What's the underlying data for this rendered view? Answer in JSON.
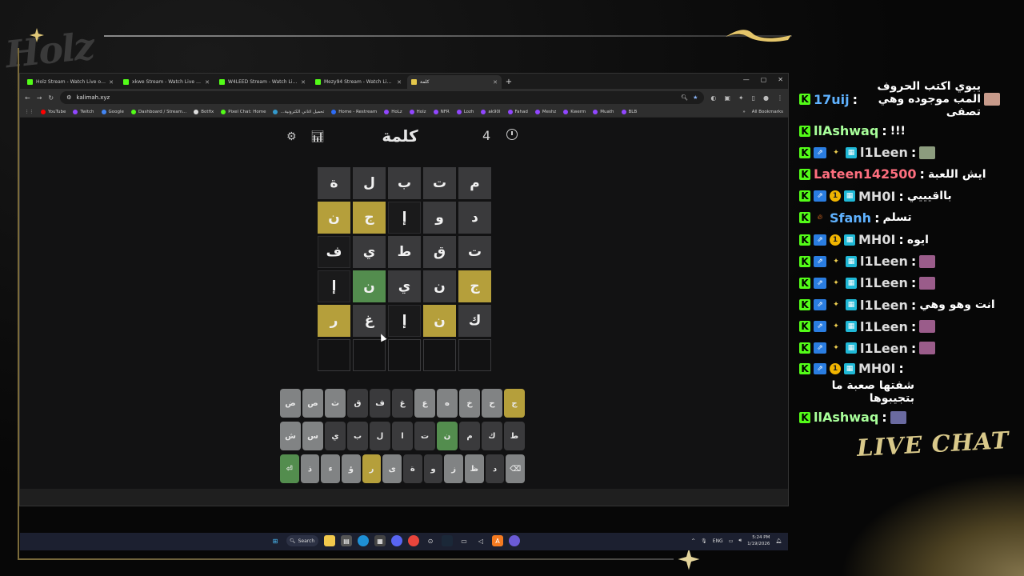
{
  "overlay": {
    "brand": "Holz",
    "live_chat_label": "LIVE CHAT"
  },
  "browser": {
    "tabs": [
      {
        "label": "Holz Stream - Watch Live on Ki",
        "active": false,
        "color": "#53fc18"
      },
      {
        "label": "xkwe Stream - Watch Live on Ki",
        "active": false,
        "color": "#53fc18"
      },
      {
        "label": "W4LEED Stream - Watch Live on",
        "active": false,
        "color": "#53fc18"
      },
      {
        "label": "Mezy94 Stream - Watch Live on",
        "active": false,
        "color": "#53fc18"
      },
      {
        "label": "كلمة",
        "active": true,
        "color": "#e4c74a"
      }
    ],
    "url": "kalimah.xyz",
    "bookmarks": [
      {
        "label": "YouTube",
        "color": "#ff0000"
      },
      {
        "label": "Twitch",
        "color": "#9146ff"
      },
      {
        "label": "Google",
        "color": "#4285f4"
      },
      {
        "label": "Dashboard / Stream...",
        "color": "#53fc18"
      },
      {
        "label": "Botfix",
        "color": "#dddddd"
      },
      {
        "label": "Pixel Chat: Home",
        "color": "#53fc18"
      },
      {
        "label": "...تحميل اغاني الكترونية",
        "color": "#39c"
      },
      {
        "label": "Home - Restream",
        "color": "#2d6cf6"
      },
      {
        "label": "HoLz",
        "color": "#9146ff"
      },
      {
        "label": "Holz",
        "color": "#9146ff"
      },
      {
        "label": "NFR",
        "color": "#9146ff"
      },
      {
        "label": "Lozh",
        "color": "#9146ff"
      },
      {
        "label": "ak90l",
        "color": "#9146ff"
      },
      {
        "label": "Fahad",
        "color": "#9146ff"
      },
      {
        "label": "Meshz",
        "color": "#9146ff"
      },
      {
        "label": "Kwerm",
        "color": "#9146ff"
      },
      {
        "label": "Muath",
        "color": "#9146ff"
      },
      {
        "label": "BLB",
        "color": "#9146ff"
      }
    ],
    "all_bookmarks": "All Bookmarks"
  },
  "game": {
    "title": "كلمة",
    "streak": "4",
    "grid": [
      [
        {
          "l": "م",
          "s": "absent"
        },
        {
          "l": "ت",
          "s": "absent"
        },
        {
          "l": "ب",
          "s": "absent"
        },
        {
          "l": "ل",
          "s": "absent"
        },
        {
          "l": "ة",
          "s": "absent"
        }
      ],
      [
        {
          "l": "د",
          "s": "absent"
        },
        {
          "l": "و",
          "s": "absent"
        },
        {
          "l": "إ",
          "s": "dark"
        },
        {
          "l": "ج",
          "s": "present"
        },
        {
          "l": "ن",
          "s": "present"
        }
      ],
      [
        {
          "l": "ت",
          "s": "absent"
        },
        {
          "l": "ق",
          "s": "absent"
        },
        {
          "l": "ط",
          "s": "absent"
        },
        {
          "l": "ي",
          "s": "absent"
        },
        {
          "l": "ف",
          "s": "dark"
        }
      ],
      [
        {
          "l": "ج",
          "s": "present"
        },
        {
          "l": "ن",
          "s": "absent"
        },
        {
          "l": "ي",
          "s": "absent"
        },
        {
          "l": "ن",
          "s": "correct"
        },
        {
          "l": "إ",
          "s": "dark"
        }
      ],
      [
        {
          "l": "ك",
          "s": "absent"
        },
        {
          "l": "ن",
          "s": "present"
        },
        {
          "l": "إ",
          "s": "dark"
        },
        {
          "l": "غ",
          "s": "absent"
        },
        {
          "l": "ر",
          "s": "present"
        }
      ],
      [
        {
          "l": "",
          "s": "empty"
        },
        {
          "l": "",
          "s": "empty"
        },
        {
          "l": "",
          "s": "empty"
        },
        {
          "l": "",
          "s": "empty"
        },
        {
          "l": "",
          "s": "empty"
        }
      ]
    ],
    "keyboard": [
      [
        {
          "k": "ج",
          "s": "present"
        },
        {
          "k": "ح",
          "s": "default"
        },
        {
          "k": "خ",
          "s": "default"
        },
        {
          "k": "ه",
          "s": "default"
        },
        {
          "k": "ع",
          "s": "default"
        },
        {
          "k": "غ",
          "s": "absent"
        },
        {
          "k": "ف",
          "s": "absent"
        },
        {
          "k": "ق",
          "s": "absent"
        },
        {
          "k": "ث",
          "s": "default"
        },
        {
          "k": "ص",
          "s": "default"
        },
        {
          "k": "ض",
          "s": "default"
        }
      ],
      [
        {
          "k": "ط",
          "s": "absent"
        },
        {
          "k": "ك",
          "s": "absent"
        },
        {
          "k": "م",
          "s": "absent"
        },
        {
          "k": "ن",
          "s": "correct"
        },
        {
          "k": "ت",
          "s": "absent"
        },
        {
          "k": "ا",
          "s": "absent"
        },
        {
          "k": "ل",
          "s": "absent"
        },
        {
          "k": "ب",
          "s": "absent"
        },
        {
          "k": "ي",
          "s": "absent"
        },
        {
          "k": "س",
          "s": "default"
        },
        {
          "k": "ش",
          "s": "default"
        }
      ],
      [
        {
          "k": "⌫",
          "s": "default"
        },
        {
          "k": "د",
          "s": "absent"
        },
        {
          "k": "ظ",
          "s": "default"
        },
        {
          "k": "ز",
          "s": "default"
        },
        {
          "k": "و",
          "s": "absent"
        },
        {
          "k": "ة",
          "s": "absent"
        },
        {
          "k": "ى",
          "s": "default"
        },
        {
          "k": "ر",
          "s": "present"
        },
        {
          "k": "ؤ",
          "s": "default"
        },
        {
          "k": "ء",
          "s": "default"
        },
        {
          "k": "ذ",
          "s": "default"
        },
        {
          "k": "⏎",
          "s": "correct"
        }
      ]
    ]
  },
  "taskbar": {
    "search_label": "Search",
    "lang": "ENG",
    "time": "5:24 PM",
    "date": "1/19/2026"
  },
  "chat": [
    {
      "user": "17uij",
      "color": "#5fb2ff",
      "badges": [],
      "text": "يبوي اكتب الحروف المب موجوده وهي تصفى",
      "emote": "#c79a8a",
      "multiline": true
    },
    {
      "user": "llAshwaq",
      "color": "#a8ff9a",
      "badges": [],
      "text": "!!!"
    },
    {
      "user": "l1Leen",
      "color": "#dddddd",
      "badges": [
        "blue",
        "star",
        "cyan"
      ],
      "text": "",
      "emote": "#8c9c7e"
    },
    {
      "user": "Lateen142500",
      "color": "#ff6f7f",
      "badges": [],
      "text": "ايش اللعبة"
    },
    {
      "user": "MH0I",
      "color": "#dddddd",
      "badges": [
        "blue",
        "gold",
        "cyan"
      ],
      "text": "بااقيييي"
    },
    {
      "user": "Sfanh",
      "color": "#5fb2ff",
      "badges": [
        "fire"
      ],
      "text": "تسلم"
    },
    {
      "user": "MH0I",
      "color": "#dddddd",
      "badges": [
        "blue",
        "gold",
        "cyan"
      ],
      "text": "ايوه"
    },
    {
      "user": "l1Leen",
      "color": "#dddddd",
      "badges": [
        "blue",
        "star",
        "cyan"
      ],
      "text": "",
      "emote": "#9a5c8a"
    },
    {
      "user": "l1Leen",
      "color": "#dddddd",
      "badges": [
        "blue",
        "star",
        "cyan"
      ],
      "text": "",
      "emote": "#9a5c8a"
    },
    {
      "user": "l1Leen",
      "color": "#dddddd",
      "badges": [
        "blue",
        "star",
        "cyan"
      ],
      "text": "انت وهو وهي"
    },
    {
      "user": "l1Leen",
      "color": "#dddddd",
      "badges": [
        "blue",
        "star",
        "cyan"
      ],
      "text": "",
      "emote": "#9a5c8a"
    },
    {
      "user": "l1Leen",
      "color": "#dddddd",
      "badges": [
        "blue",
        "star",
        "cyan"
      ],
      "text": "",
      "emote": "#9a5c8a"
    },
    {
      "user": "MH0I",
      "color": "#dddddd",
      "badges": [
        "blue",
        "gold",
        "cyan"
      ],
      "text": "شفتها صعبة ما بتجيبوها",
      "multiline": true
    },
    {
      "user": "llAshwaq",
      "color": "#a8ff9a",
      "badges": [],
      "text": "",
      "emote": "#6a6aa0"
    }
  ]
}
